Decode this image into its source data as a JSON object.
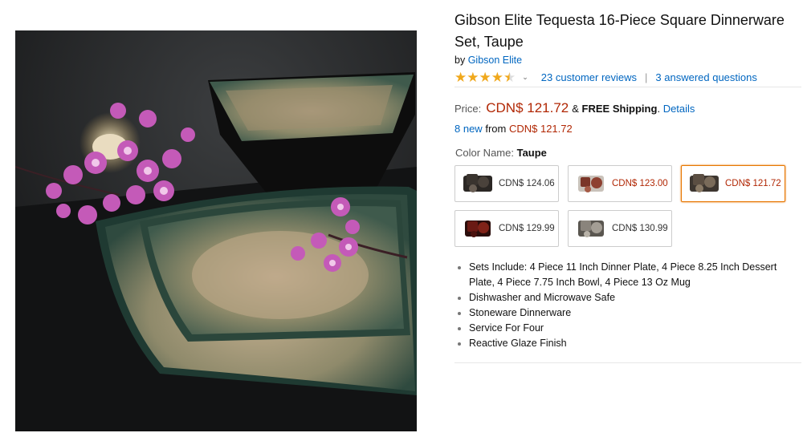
{
  "product": {
    "title": "Gibson Elite Tequesta 16-Piece Square Dinnerware Set, Taupe",
    "by_prefix": "by",
    "brand": "Gibson Elite",
    "rating": 4.5,
    "reviews_link": "23 customer reviews",
    "questions_link": "3 answered questions",
    "price_label": "Price:",
    "price": "CDN$ 121.72",
    "shipping_amp": "&",
    "shipping_free": "FREE Shipping",
    "shipping_period": ".",
    "details_link": "Details",
    "new_count_link": "8 new",
    "new_from": "from",
    "new_price": "CDN$ 121.72",
    "color_label": "Color Name:",
    "color_value": "Taupe"
  },
  "swatches": [
    {
      "price": "CDN$ 124.06",
      "selected": false,
      "color": "#3a342f"
    },
    {
      "price": "CDN$ 123.00",
      "selected": false,
      "color": "#7a3528"
    },
    {
      "price": "CDN$ 121.72",
      "selected": true,
      "color": "#5b4e42"
    },
    {
      "price": "CDN$ 129.99",
      "selected": false,
      "color": "#6a1a14"
    },
    {
      "price": "CDN$ 130.99",
      "selected": false,
      "color": "#8a847c"
    }
  ],
  "features": [
    "Sets Include: 4 Piece 11 Inch Dinner Plate, 4 Piece 8.25 Inch Dessert Plate, 4 Piece 7.75 Inch Bowl, 4 Piece 13 Oz Mug",
    "Dishwasher and Microwave Safe",
    "Stoneware Dinnerware",
    "Service For Four",
    "Reactive Glaze Finish"
  ],
  "colors": {
    "link": "#0066c0",
    "price": "#b12704",
    "star": "#f0a81c",
    "selected_border": "#e77600"
  }
}
